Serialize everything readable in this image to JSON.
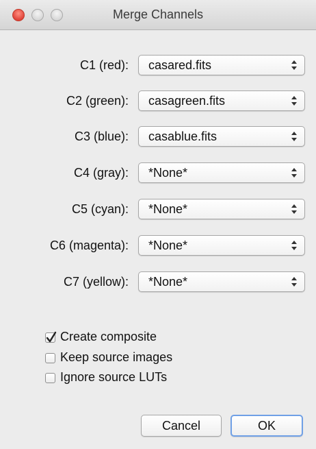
{
  "window": {
    "title": "Merge Channels"
  },
  "channels": [
    {
      "label": "C1 (red):",
      "value": "casared.fits"
    },
    {
      "label": "C2 (green):",
      "value": "casagreen.fits"
    },
    {
      "label": "C3 (blue):",
      "value": "casablue.fits"
    },
    {
      "label": "C4 (gray):",
      "value": "*None*"
    },
    {
      "label": "C5 (cyan):",
      "value": "*None*"
    },
    {
      "label": "C6 (magenta):",
      "value": "*None*"
    },
    {
      "label": "C7 (yellow):",
      "value": "*None*"
    }
  ],
  "options": [
    {
      "label": "Create composite",
      "checked": true
    },
    {
      "label": "Keep source images",
      "checked": false
    },
    {
      "label": "Ignore source LUTs",
      "checked": false
    }
  ],
  "buttons": {
    "cancel_label": "Cancel",
    "ok_label": "OK"
  },
  "icons": {
    "close": "close-icon",
    "minimize": "minimize-icon",
    "zoom": "zoom-icon",
    "popup_arrows": "chevron-up-down-icon",
    "checkmark": "checkmark-icon"
  }
}
